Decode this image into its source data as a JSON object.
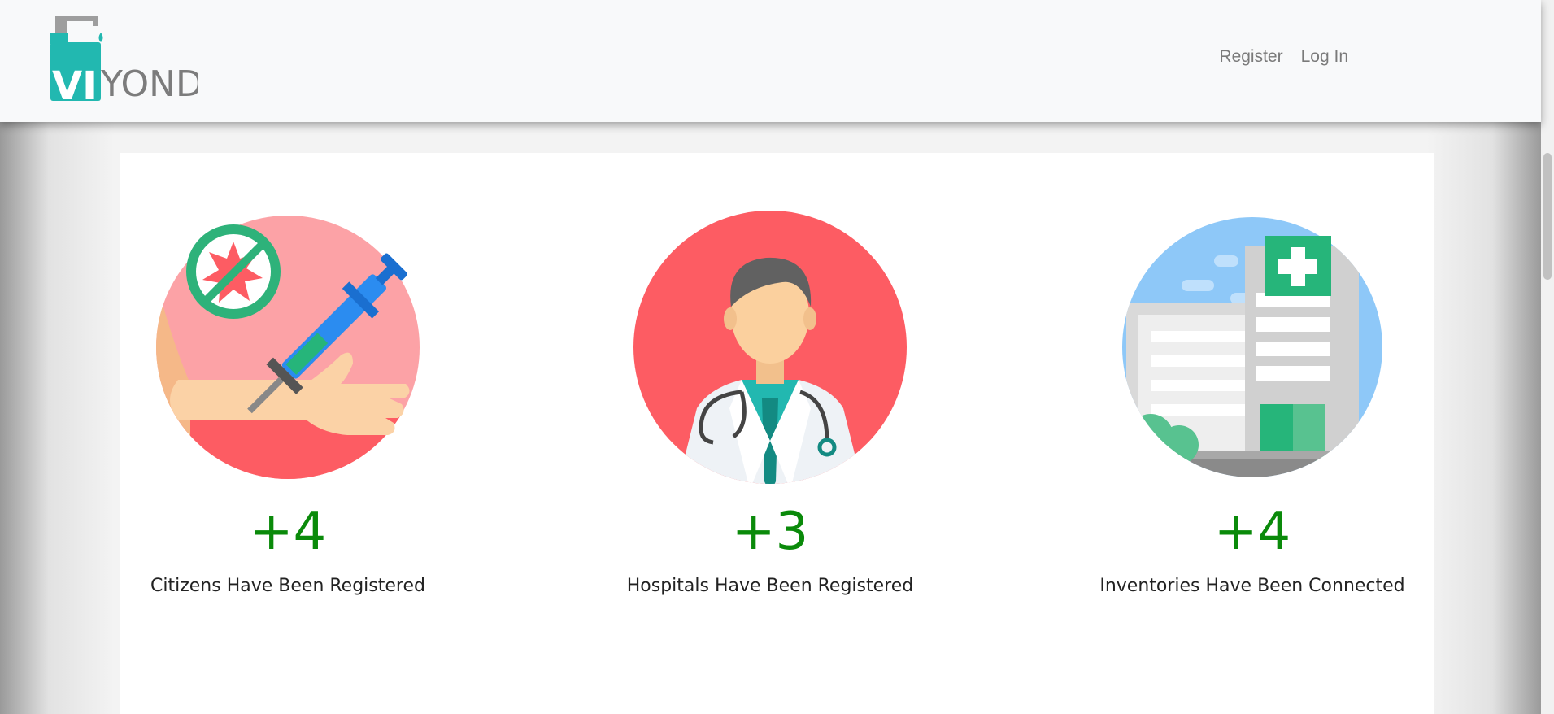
{
  "brand": {
    "logo_text_vi": "VI",
    "logo_text_yond": "YOND"
  },
  "nav": {
    "register_label": "Register",
    "login_label": "Log In"
  },
  "stats": [
    {
      "number": "+4",
      "caption": "Citizens Have Been Registered",
      "icon": "vaccine-syringe-icon"
    },
    {
      "number": "+3",
      "caption": "Hospitals Have Been Registered",
      "icon": "doctor-icon"
    },
    {
      "number": "+4",
      "caption": "Inventories Have Been Connected",
      "icon": "hospital-building-icon"
    }
  ],
  "colors": {
    "accent_green": "#0a8a0a",
    "circle_red": "#fd5c63",
    "circle_pink": "#fca2a6",
    "teal": "#22b8b0",
    "sky_blue": "#8ec8f8"
  }
}
